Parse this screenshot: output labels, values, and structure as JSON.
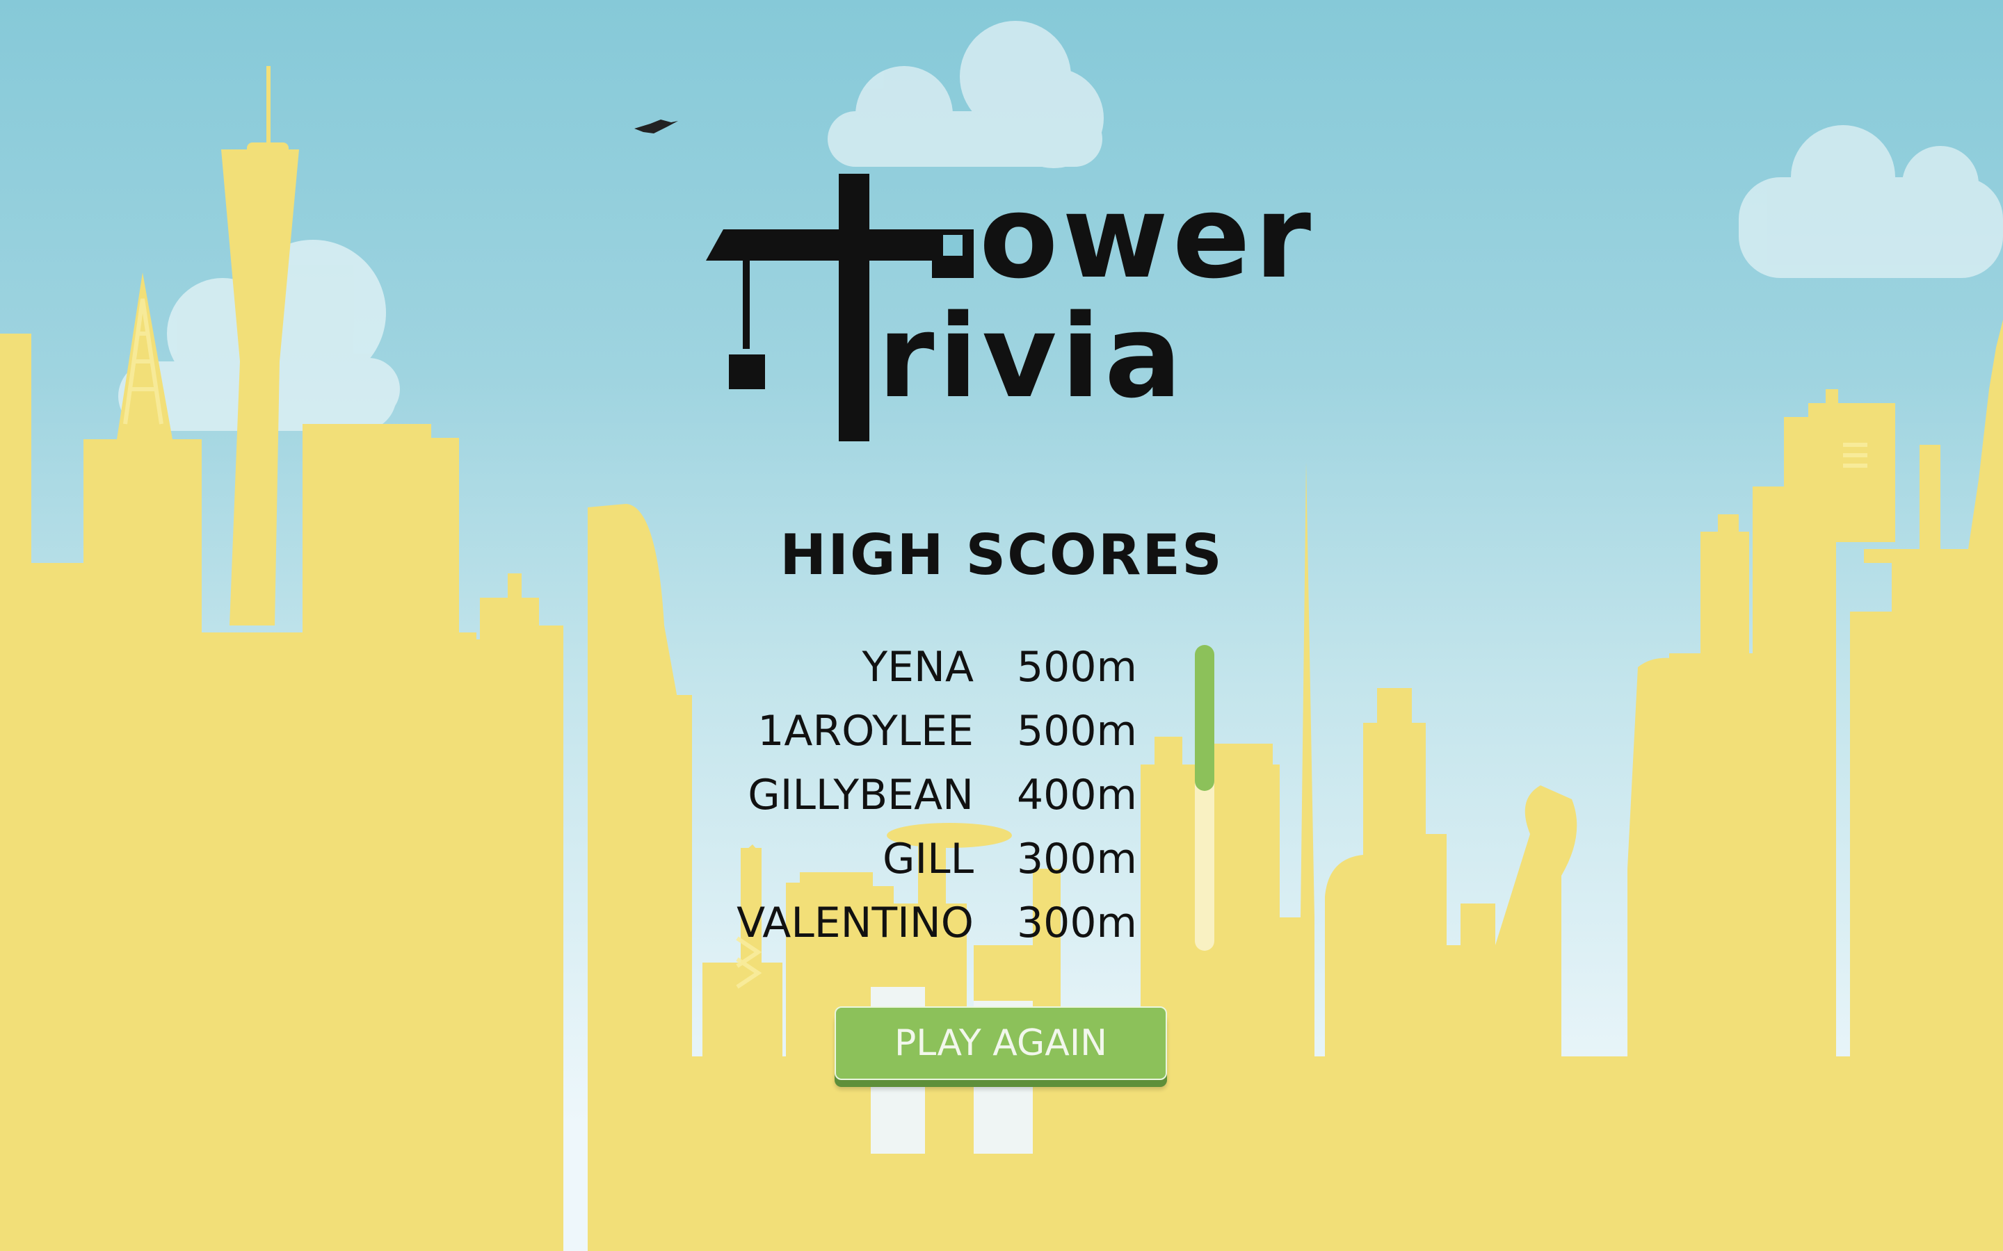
{
  "game": {
    "logo_line1": "ower",
    "logo_line2": "rivia"
  },
  "high_scores": {
    "title": "HIGH SCORES",
    "entries": [
      {
        "name": "YENA",
        "score": "500m"
      },
      {
        "name": "1AROYLEE",
        "score": "500m"
      },
      {
        "name": "GILLYBEAN",
        "score": "400m"
      },
      {
        "name": "GILL",
        "score": "300m"
      },
      {
        "name": "VALENTINO",
        "score": "300m"
      }
    ],
    "scroll_position": 0.0
  },
  "play_again": {
    "label": "PLAY AGAIN"
  },
  "colors": {
    "sky_top": "#86c9d8",
    "buildings": "#f2df78",
    "accent_green": "#8cc15a",
    "text": "#111111"
  }
}
